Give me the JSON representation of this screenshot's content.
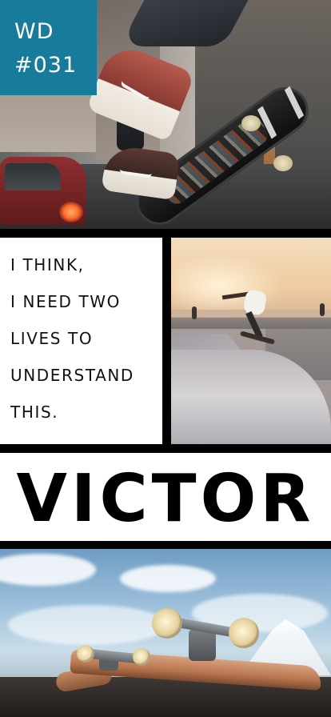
{
  "badge": {
    "line1": "WD",
    "line2": "#031",
    "color": "#177b9b"
  },
  "quote": {
    "lines": [
      "I THINK,",
      "I NEED TWO",
      "LIVES TO",
      "UNDERSTAND",
      "THIS."
    ]
  },
  "title": "VICTOR",
  "colors": {
    "background": "#000000",
    "panel": "#ffffff",
    "text": "#111111"
  }
}
